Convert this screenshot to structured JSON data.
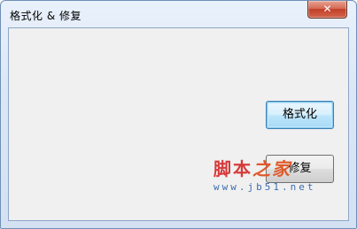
{
  "window": {
    "title": "格式化 & 修复",
    "close_glyph": "✕"
  },
  "buttons": {
    "format_label": "格式化",
    "repair_label": "修复"
  },
  "watermark": {
    "text_main": "脚本",
    "text_accent": "之家",
    "url": "www.jb51.net"
  }
}
